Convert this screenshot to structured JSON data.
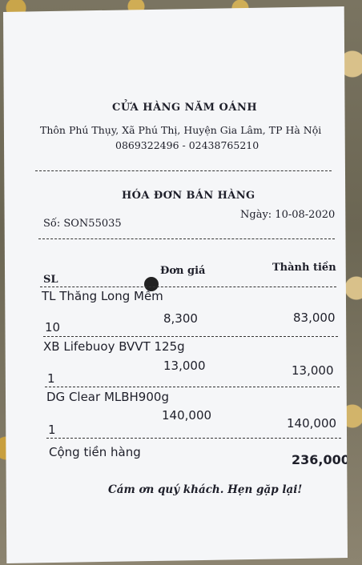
{
  "receipt": {
    "shop_name": "CỬA HÀNG NĂM OÁNH",
    "address": "Thôn Phú Thụy, Xã Phú Thị, Huyện Gia Lâm, TP Hà Nội",
    "phone": "0869322496 - 02438765210",
    "title": "HÓA ĐƠN BÁN HÀNG",
    "invoice_number": "Số: SON55035",
    "date": "Ngày: 10-08-2020",
    "columns": {
      "qty": "SL",
      "unit_price": "Đơn giá",
      "amount": "Thành tiền"
    },
    "items": [
      {
        "name": "TL Thăng Long Mềm",
        "qty": "10",
        "unit_price": "8,300",
        "amount": "83,000"
      },
      {
        "name": "XB Lifebuoy BVVT 125g",
        "qty": "1",
        "unit_price": "13,000",
        "amount": "13,000"
      },
      {
        "name": "DG Clear MLBH900g",
        "qty": "1",
        "unit_price": "140,000",
        "amount": "140,000"
      }
    ],
    "total_label": "Cộng tiền hàng",
    "total_value": "236,000",
    "thanks": "Cám ơn quý khách. Hẹn gặp lại!"
  }
}
